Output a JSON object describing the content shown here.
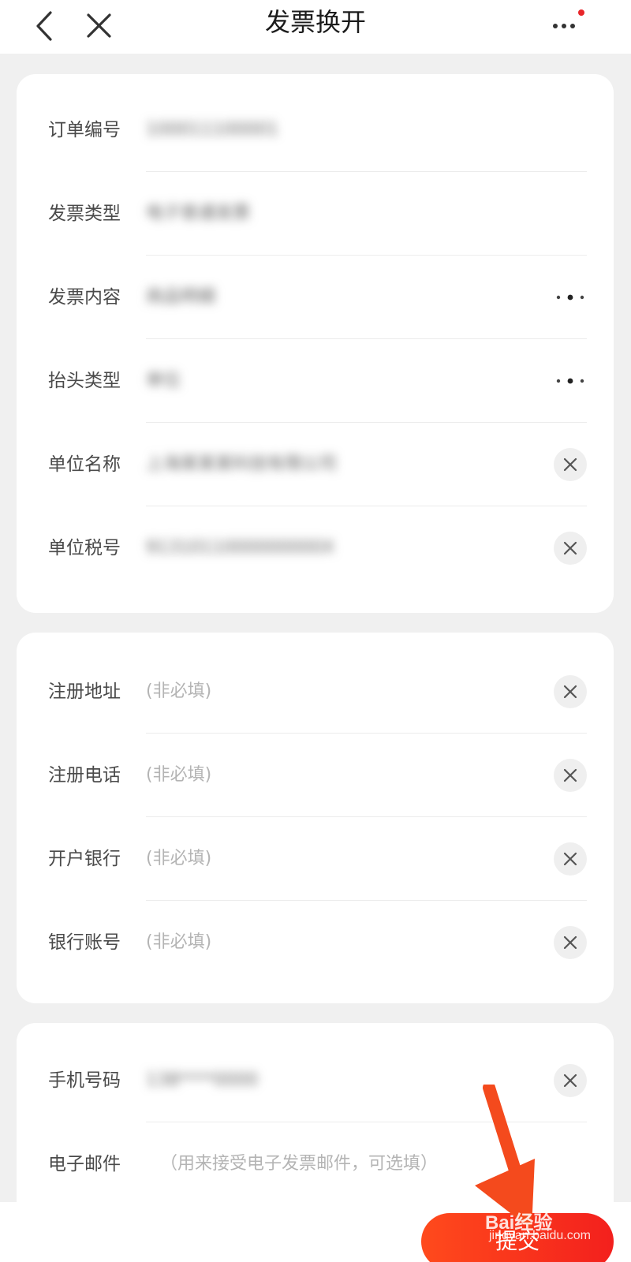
{
  "nav": {
    "title": "发票换开",
    "back_icon": "chevron-left-icon",
    "close_icon": "close-icon",
    "more_icon": "more-horizontal-icon",
    "notification_color": "#e8262a"
  },
  "invoice_info": {
    "rows": [
      {
        "label": "订单编号",
        "value": "100011100001",
        "action": "none"
      },
      {
        "label": "发票类型",
        "value": "电子普通发票",
        "action": "none"
      },
      {
        "label": "发票内容",
        "value": "商品明细",
        "action": "more"
      },
      {
        "label": "抬头类型",
        "value": "单位",
        "action": "more"
      },
      {
        "label": "单位名称",
        "value": "上海某某某科技有限公司",
        "action": "clear"
      },
      {
        "label": "单位税号",
        "value": "9131011000000000X",
        "action": "clear"
      }
    ]
  },
  "optional_info": {
    "rows": [
      {
        "label": "注册地址",
        "placeholder": "(非必填)"
      },
      {
        "label": "注册电话",
        "placeholder": "(非必填)"
      },
      {
        "label": "开户银行",
        "placeholder": "(非必填)"
      },
      {
        "label": "银行账号",
        "placeholder": "(非必填)"
      }
    ]
  },
  "contact_info": {
    "phone_label": "手机号码",
    "phone_value": "138****0000",
    "email_label": "电子邮件",
    "email_placeholder": "（用来接受电子发票邮件，可选填）"
  },
  "submit": {
    "label": "提交",
    "color": "#f3201d"
  },
  "watermark": {
    "text": "Bai经验",
    "subtext": "jingyan.baidu.com"
  }
}
